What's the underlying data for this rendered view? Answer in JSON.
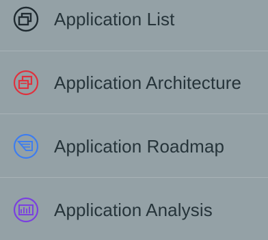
{
  "menu": {
    "items": [
      {
        "label": "Application List",
        "icon": "application-list-icon",
        "color": "#1f2a30"
      },
      {
        "label": "Application Architecture",
        "icon": "application-architecture-icon",
        "color": "#e0303c"
      },
      {
        "label": "Application Roadmap",
        "icon": "application-roadmap-icon",
        "color": "#3d7df0"
      },
      {
        "label": "Application Analysis",
        "icon": "application-analysis-icon",
        "color": "#7a3fe0"
      }
    ]
  }
}
